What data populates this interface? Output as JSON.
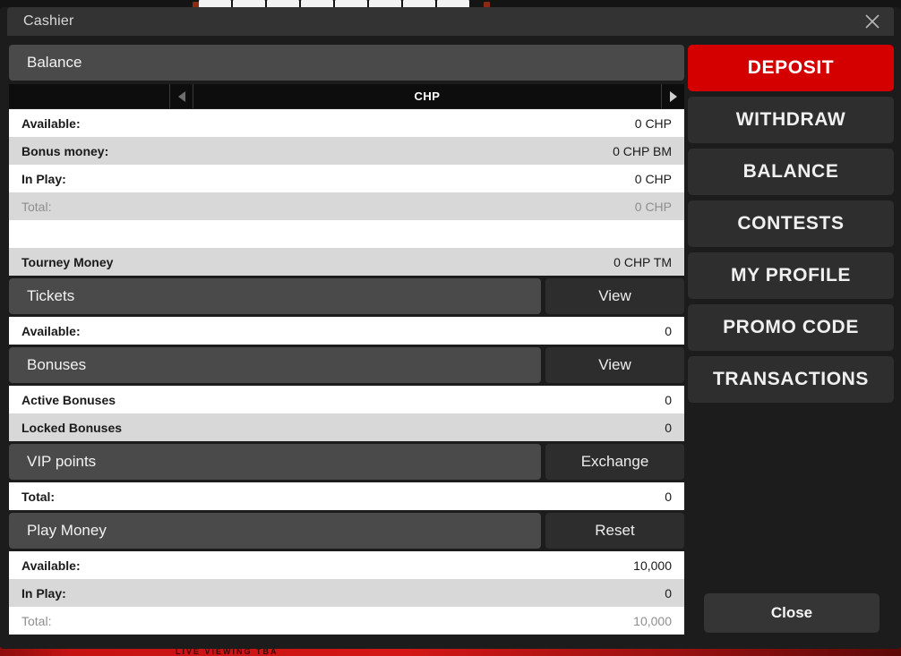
{
  "window": {
    "title": "Cashier",
    "close_icon": "close-x-icon"
  },
  "background": {
    "bottom_banner_text": "LIVE VIEWING TBA"
  },
  "balance": {
    "header": "Balance",
    "currency": {
      "selected": "CHP",
      "prev_icon": "triangle-left-icon",
      "next_icon": "triangle-right-icon"
    },
    "rows": [
      {
        "label": "Available:",
        "value": "0 CHP"
      },
      {
        "label": "Bonus money:",
        "value": "0 CHP BM"
      },
      {
        "label": "In Play:",
        "value": "0 CHP"
      },
      {
        "label": "Total:",
        "value": "0 CHP"
      },
      {
        "label": "",
        "value": ""
      },
      {
        "label": "Tourney Money",
        "value": "0 CHP TM"
      }
    ]
  },
  "tickets": {
    "header": "Tickets",
    "action": "View",
    "rows": [
      {
        "label": "Available:",
        "value": "0"
      }
    ]
  },
  "bonuses": {
    "header": "Bonuses",
    "action": "View",
    "rows": [
      {
        "label": "Active Bonuses",
        "value": "0"
      },
      {
        "label": "Locked Bonuses",
        "value": "0"
      }
    ]
  },
  "vip_points": {
    "header": "VIP points",
    "action": "Exchange",
    "rows": [
      {
        "label": "Total:",
        "value": "0"
      }
    ]
  },
  "play_money": {
    "header": "Play Money",
    "action": "Reset",
    "rows": [
      {
        "label": "Available:",
        "value": "10,000"
      },
      {
        "label": "In Play:",
        "value": "0"
      },
      {
        "label": "Total:",
        "value": "10,000"
      }
    ]
  },
  "sidebar": {
    "items": [
      {
        "label": "DEPOSIT",
        "active": true
      },
      {
        "label": "WITHDRAW",
        "active": false
      },
      {
        "label": "BALANCE",
        "active": false
      },
      {
        "label": "CONTESTS",
        "active": false
      },
      {
        "label": "MY PROFILE",
        "active": false
      },
      {
        "label": "PROMO CODE",
        "active": false
      },
      {
        "label": "TRANSACTIONS",
        "active": false
      }
    ],
    "close_label": "Close"
  },
  "colors": {
    "accent_red": "#d40000",
    "window_bg": "#1c1c1c",
    "titlebar": "#333333",
    "section_header": "#4a4a4a",
    "action_btn": "#2d2d2d",
    "row_light": "#ffffff",
    "row_dark": "#d8d8d8"
  }
}
